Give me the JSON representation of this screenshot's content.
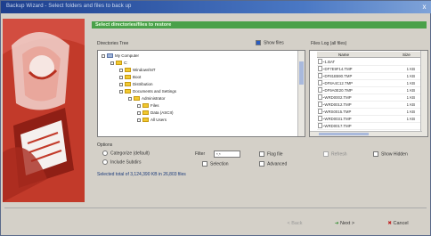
{
  "window": {
    "title": "Backup Wizard - Select folders and files to back up",
    "close_label": "x"
  },
  "header": {
    "label": "Select directories/files to restore"
  },
  "tree_panel": {
    "heading": "Directories Tree",
    "show_files_label": "Show files",
    "items": [
      {
        "label": "My Computer"
      },
      {
        "label": "C:"
      },
      {
        "label": "Windows\\NT"
      },
      {
        "label": "Boot"
      },
      {
        "label": "Distribution"
      },
      {
        "label": "Documents and Settings"
      },
      {
        "label": "Administrator"
      },
      {
        "label": "Files"
      },
      {
        "label": "Data (ASCII)"
      },
      {
        "label": "All Users"
      }
    ]
  },
  "files_panel": {
    "heading": "Files Log (all files)",
    "columns": {
      "name": "Name",
      "size": "Size"
    },
    "rows": [
      {
        "name": "~1.BAT",
        "size": ""
      },
      {
        "name": "~DF7E9F14.TMP",
        "size": "1 KB"
      },
      {
        "name": "~DF81B590.TMP",
        "size": "1 KB"
      },
      {
        "name": "~DF8A4C12.TMP",
        "size": "1 KB"
      },
      {
        "name": "~DF9A0E20.TMP",
        "size": "1 KB"
      },
      {
        "name": "~WRD0002.TMP",
        "size": "1 KB"
      },
      {
        "name": "~WRD0012.TMP",
        "size": "1 KB"
      },
      {
        "name": "~WRS0015.TMP",
        "size": "1 KB"
      },
      {
        "name": "~WRD0031.TMP",
        "size": "1 KB"
      },
      {
        "name": "~WRD0017.TMP",
        "size": ""
      }
    ]
  },
  "options": {
    "heading": "Options",
    "categorize_label": "Categorize (default)",
    "include_subdirs_label": "Include Subdirs",
    "filter_label": "Filter",
    "filter_value": "*.*",
    "selection_label": "Selection",
    "flag_file_label": "Flag file",
    "advanced_label": "Advanced",
    "total_text": "Selected total of 3,124,390 KB in 26,803 files",
    "refresh_label": "Refresh",
    "show_hidden_label": "Show Hidden"
  },
  "buttons": {
    "back": "< Back",
    "next": "Next >",
    "cancel": "Cancel"
  }
}
